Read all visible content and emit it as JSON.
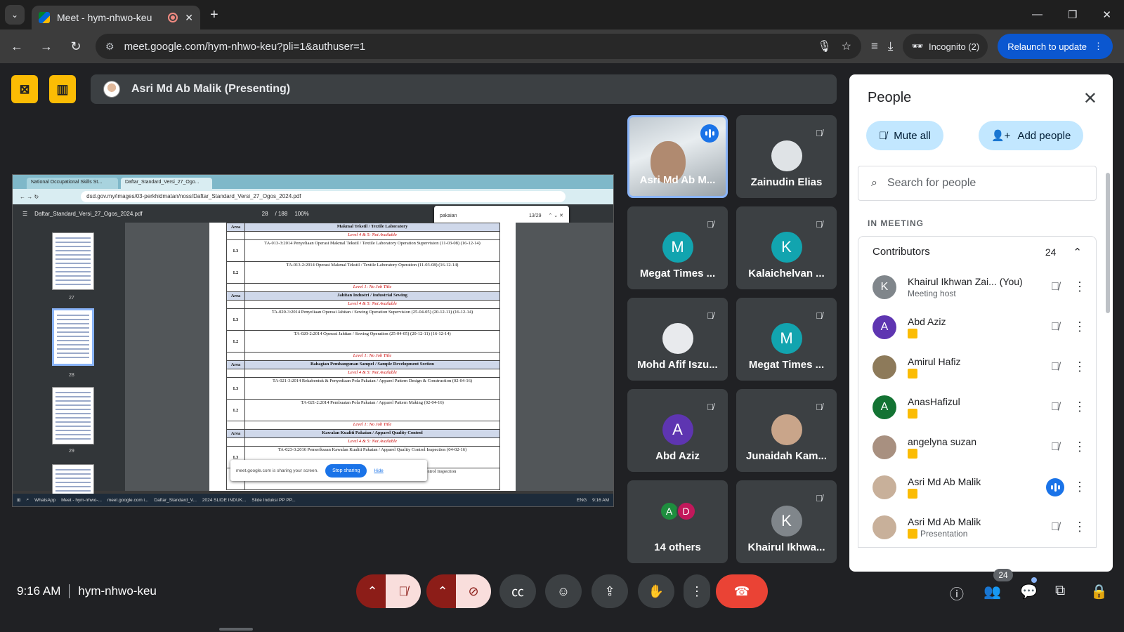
{
  "browser": {
    "tab_title": "Meet - hym-nhwo-keu",
    "url": "meet.google.com/hym-nhwo-keu?pli=1&authuser=1",
    "incognito_label": "Incognito (2)",
    "relaunch_label": "Relaunch to update"
  },
  "presenting": {
    "label": "Asri Md Ab Malik (Presenting)"
  },
  "shared_screen": {
    "tabs": [
      "National Occupational Skills St...",
      "Daftar_Standard_Versi_27_Ogo..."
    ],
    "url": "dsd.gov.my/images/03-perkhidmatan/noss/Daftar_Standard_Versi_27_Ogos_2024.pdf",
    "pdf_title": "Daftar_Standard_Versi_27_Ogos_2024.pdf",
    "page_current": "28",
    "page_total": "/ 188",
    "zoom": "100%",
    "find_text": "pakaian",
    "find_count": "13/29",
    "thumb_labels": [
      "27",
      "28",
      "29"
    ],
    "doc_rows": [
      {
        "type": "area",
        "level": "Area",
        "text": "Makmal Tekstil / Textile Laboratory"
      },
      {
        "type": "note",
        "level": "",
        "text": "Level 4 & 5: Not Available"
      },
      {
        "type": "item",
        "level": "L3",
        "text": "TA-013-3:2014 Penyeliaan Operasi Makmal Tekstil / Textile Laboratory Operation Supervision (11-03-08) (16-12-14)"
      },
      {
        "type": "item",
        "level": "L2",
        "text": "TA-013-2:2014 Operasi Makmal Tekstil / Textile Laboratory Operation (11-03-08) (16-12-14)"
      },
      {
        "type": "note",
        "level": "",
        "text": "Level 1: No Job Title"
      },
      {
        "type": "area",
        "level": "Area",
        "text": "Jahitan Industri / Industrial Sewing"
      },
      {
        "type": "note",
        "level": "",
        "text": "Level 4 & 5: Not Available"
      },
      {
        "type": "item",
        "level": "L3",
        "text": "TA-020-3:2014 Penyeliaan Operasi Jahitan / Sewing Operation Supervision (25-04-05) (20-12-11) (16-12-14)"
      },
      {
        "type": "item",
        "level": "L2",
        "text": "TA-020-2:2014 Operasi Jahitan / Sewing Operation (25-04-05) (20-12-11) (16-12-14)"
      },
      {
        "type": "note",
        "level": "",
        "text": "Level 1: No Job Title"
      },
      {
        "type": "area",
        "level": "Area",
        "text": "Bahagian Pembangunan Sampel / Sample Development Section"
      },
      {
        "type": "note",
        "level": "",
        "text": "Level 4 & 5: Not Available"
      },
      {
        "type": "item",
        "level": "L3",
        "text": "TA-021-3:2014 Rekabentuk & Penyediaan Pola Pakaian / Apparel Pattern Design & Construction (02-04-16)"
      },
      {
        "type": "item",
        "level": "L2",
        "text": "TA-021-2:2014 Pembuatan Pola Pakaian / Apparel Pattern Making (02-04-16)"
      },
      {
        "type": "note",
        "level": "",
        "text": "Level 1: No Job Title"
      },
      {
        "type": "area",
        "level": "Area",
        "text": "Kawalan Kualiti Pakaian / Apparel Quality Control"
      },
      {
        "type": "note",
        "level": "",
        "text": "Level 4 & 5: Not Available"
      },
      {
        "type": "item",
        "level": "L3",
        "text": "TA-023-3:2016 Pemeriksaan Kawalan Kualiti Pakaian / Apparel Quality Control Inspection (04-02-16)"
      },
      {
        "type": "item",
        "level": "L2",
        "text": "TA-023-2:2016 Pemeriksaan Kawalan Kualiti Pakaian / Apparel Quality Control Inspection"
      }
    ],
    "share_notice": "meet.google.com is sharing your screen.",
    "stop_sharing": "Stop sharing",
    "hide": "Hide",
    "taskbar_items": [
      "WhatsApp",
      "Meet - hym-nhwo-...",
      "meet.google.com i...",
      "Daftar_Standard_V...",
      "2024 SLIDE INDUK...",
      "Slide Induksi PP PP..."
    ],
    "taskbar_lang": "ENG",
    "taskbar_time": "9:16 AM"
  },
  "tiles": [
    {
      "name": "Asri Md Ab M...",
      "initial": "",
      "color": "",
      "speaking": true
    },
    {
      "name": "Zainudin Elias",
      "initial": "",
      "color": "#dfe3e6",
      "speaking": false
    },
    {
      "name": "Megat Times ...",
      "initial": "M",
      "color": "#12a4af",
      "speaking": false
    },
    {
      "name": "Kalaichelvan ...",
      "initial": "K",
      "color": "#12a4af",
      "speaking": false
    },
    {
      "name": "Mohd Afif Iszu...",
      "initial": "",
      "color": "#e8eaed",
      "speaking": false
    },
    {
      "name": "Megat Times ...",
      "initial": "M",
      "color": "#12a4af",
      "speaking": false
    },
    {
      "name": "Abd Aziz",
      "initial": "A",
      "color": "#5e35b1",
      "speaking": false
    },
    {
      "name": "Junaidah Kam...",
      "initial": "",
      "color": "#c9a58a",
      "speaking": false
    },
    {
      "name": "14 others",
      "initial": "",
      "color": "",
      "speaking": false
    },
    {
      "name": "Khairul Ikhwa...",
      "initial": "K",
      "color": "#80868b",
      "speaking": false
    }
  ],
  "others_avatars": [
    {
      "initial": "A",
      "color": "#1e8e3e"
    },
    {
      "initial": "D",
      "color": "#c2185b"
    }
  ],
  "people": {
    "title": "People",
    "mute_all": "Mute all",
    "add_people": "Add people",
    "search_placeholder": "Search for people",
    "in_meeting": "IN MEETING",
    "contributors_label": "Contributors",
    "contributors_count": "24",
    "list": [
      {
        "name": "Khairul Ikhwan Zai... (You)",
        "sub": "Meeting host",
        "initial": "K",
        "color": "#80868b",
        "presenting_icon": false,
        "speaking": false
      },
      {
        "name": "Abd Aziz",
        "sub": "",
        "initial": "A",
        "color": "#5e35b1",
        "presenting_icon": true,
        "speaking": false
      },
      {
        "name": "Amirul Hafiz",
        "sub": "",
        "initial": "",
        "color": "#8d7a5a",
        "presenting_icon": true,
        "speaking": false
      },
      {
        "name": "AnasHafizul",
        "sub": "",
        "initial": "A",
        "color": "#137333",
        "presenting_icon": true,
        "speaking": false
      },
      {
        "name": "angelyna suzan",
        "sub": "",
        "initial": "",
        "color": "#a89080",
        "presenting_icon": true,
        "speaking": false
      },
      {
        "name": "Asri Md Ab Malik",
        "sub": "",
        "initial": "",
        "color": "#c8b09a",
        "presenting_icon": true,
        "speaking": true
      },
      {
        "name": "Asri Md Ab Malik",
        "sub": "Presentation",
        "initial": "",
        "color": "#c8b09a",
        "presenting_icon": true,
        "speaking": false
      }
    ]
  },
  "bottom": {
    "time": "9:16 AM",
    "meeting_code": "hym-nhwo-keu",
    "participants_count": "24"
  }
}
